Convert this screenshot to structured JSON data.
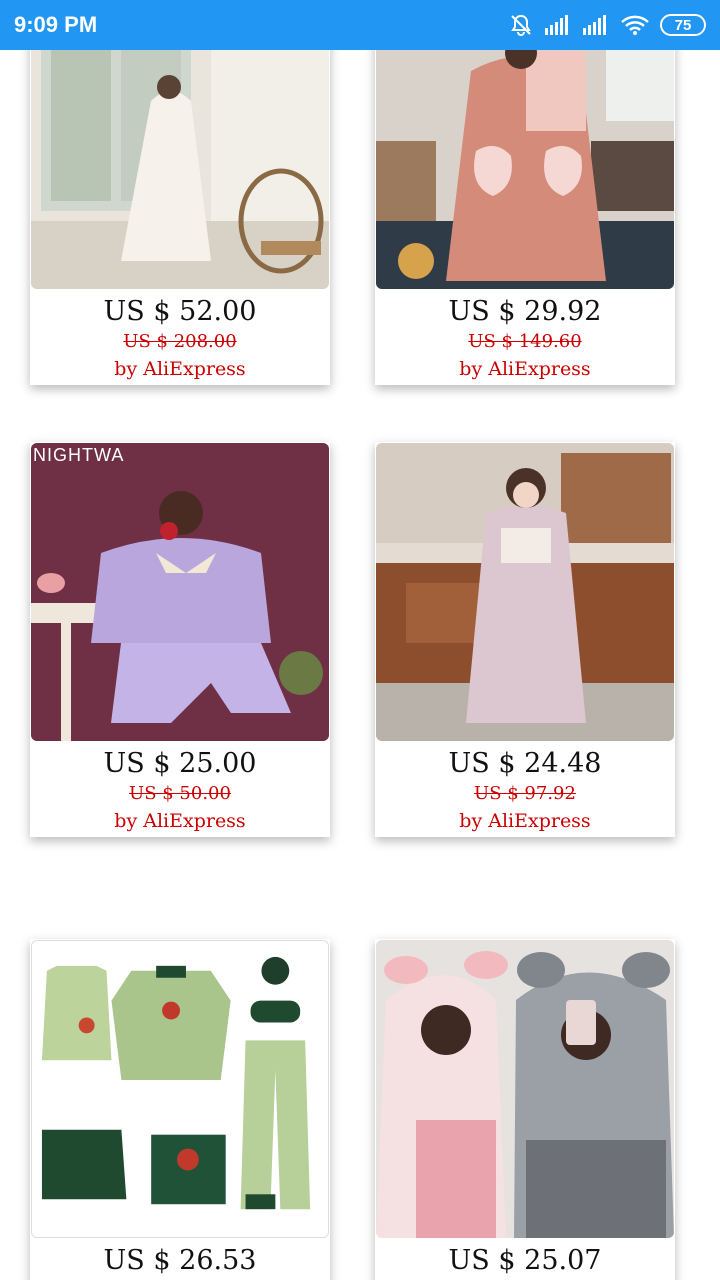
{
  "status_bar": {
    "time": "9:09 PM",
    "battery": "75",
    "icons": [
      "mute-alarm-icon",
      "signal-icon",
      "signal-icon",
      "wifi-icon",
      "battery-icon"
    ]
  },
  "products": [
    {
      "price": "US $ 52.00",
      "original_price": "US $ 208.00",
      "seller": "by AliExpress",
      "image": "white-nightgown-photo"
    },
    {
      "price": "US $ 29.92",
      "original_price": "US $ 149.60",
      "seller": "by AliExpress",
      "image": "pink-robe-photo"
    },
    {
      "price": "US $ 25.00",
      "original_price": "US $ 50.00",
      "seller": "by AliExpress",
      "image": "purple-pajama-photo",
      "photo_text": "NIGHTWA"
    },
    {
      "price": "US $ 24.48",
      "original_price": "US $ 97.92",
      "seller": "by AliExpress",
      "image": "lilac-nightdress-photo"
    },
    {
      "price": "US $ 26.53",
      "original_price": "",
      "seller": "",
      "image": "green-pajama-set-photo"
    },
    {
      "price": "US $ 25.07",
      "original_price": "",
      "seller": "",
      "image": "animal-onesie-photo"
    }
  ],
  "colors": {
    "status_bar": "#2196f3",
    "sale_red": "#cc0000"
  }
}
